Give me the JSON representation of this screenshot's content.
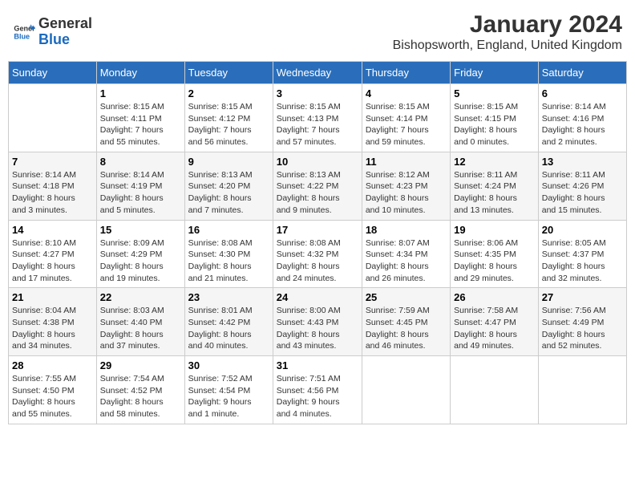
{
  "header": {
    "logo_general": "General",
    "logo_blue": "Blue",
    "main_title": "January 2024",
    "sub_title": "Bishopsworth, England, United Kingdom"
  },
  "days_of_week": [
    "Sunday",
    "Monday",
    "Tuesday",
    "Wednesday",
    "Thursday",
    "Friday",
    "Saturday"
  ],
  "weeks": [
    [
      {
        "day": "",
        "info": ""
      },
      {
        "day": "1",
        "info": "Sunrise: 8:15 AM\nSunset: 4:11 PM\nDaylight: 7 hours\nand 55 minutes."
      },
      {
        "day": "2",
        "info": "Sunrise: 8:15 AM\nSunset: 4:12 PM\nDaylight: 7 hours\nand 56 minutes."
      },
      {
        "day": "3",
        "info": "Sunrise: 8:15 AM\nSunset: 4:13 PM\nDaylight: 7 hours\nand 57 minutes."
      },
      {
        "day": "4",
        "info": "Sunrise: 8:15 AM\nSunset: 4:14 PM\nDaylight: 7 hours\nand 59 minutes."
      },
      {
        "day": "5",
        "info": "Sunrise: 8:15 AM\nSunset: 4:15 PM\nDaylight: 8 hours\nand 0 minutes."
      },
      {
        "day": "6",
        "info": "Sunrise: 8:14 AM\nSunset: 4:16 PM\nDaylight: 8 hours\nand 2 minutes."
      }
    ],
    [
      {
        "day": "7",
        "info": "Sunrise: 8:14 AM\nSunset: 4:18 PM\nDaylight: 8 hours\nand 3 minutes."
      },
      {
        "day": "8",
        "info": "Sunrise: 8:14 AM\nSunset: 4:19 PM\nDaylight: 8 hours\nand 5 minutes."
      },
      {
        "day": "9",
        "info": "Sunrise: 8:13 AM\nSunset: 4:20 PM\nDaylight: 8 hours\nand 7 minutes."
      },
      {
        "day": "10",
        "info": "Sunrise: 8:13 AM\nSunset: 4:22 PM\nDaylight: 8 hours\nand 9 minutes."
      },
      {
        "day": "11",
        "info": "Sunrise: 8:12 AM\nSunset: 4:23 PM\nDaylight: 8 hours\nand 10 minutes."
      },
      {
        "day": "12",
        "info": "Sunrise: 8:11 AM\nSunset: 4:24 PM\nDaylight: 8 hours\nand 13 minutes."
      },
      {
        "day": "13",
        "info": "Sunrise: 8:11 AM\nSunset: 4:26 PM\nDaylight: 8 hours\nand 15 minutes."
      }
    ],
    [
      {
        "day": "14",
        "info": "Sunrise: 8:10 AM\nSunset: 4:27 PM\nDaylight: 8 hours\nand 17 minutes."
      },
      {
        "day": "15",
        "info": "Sunrise: 8:09 AM\nSunset: 4:29 PM\nDaylight: 8 hours\nand 19 minutes."
      },
      {
        "day": "16",
        "info": "Sunrise: 8:08 AM\nSunset: 4:30 PM\nDaylight: 8 hours\nand 21 minutes."
      },
      {
        "day": "17",
        "info": "Sunrise: 8:08 AM\nSunset: 4:32 PM\nDaylight: 8 hours\nand 24 minutes."
      },
      {
        "day": "18",
        "info": "Sunrise: 8:07 AM\nSunset: 4:34 PM\nDaylight: 8 hours\nand 26 minutes."
      },
      {
        "day": "19",
        "info": "Sunrise: 8:06 AM\nSunset: 4:35 PM\nDaylight: 8 hours\nand 29 minutes."
      },
      {
        "day": "20",
        "info": "Sunrise: 8:05 AM\nSunset: 4:37 PM\nDaylight: 8 hours\nand 32 minutes."
      }
    ],
    [
      {
        "day": "21",
        "info": "Sunrise: 8:04 AM\nSunset: 4:38 PM\nDaylight: 8 hours\nand 34 minutes."
      },
      {
        "day": "22",
        "info": "Sunrise: 8:03 AM\nSunset: 4:40 PM\nDaylight: 8 hours\nand 37 minutes."
      },
      {
        "day": "23",
        "info": "Sunrise: 8:01 AM\nSunset: 4:42 PM\nDaylight: 8 hours\nand 40 minutes."
      },
      {
        "day": "24",
        "info": "Sunrise: 8:00 AM\nSunset: 4:43 PM\nDaylight: 8 hours\nand 43 minutes."
      },
      {
        "day": "25",
        "info": "Sunrise: 7:59 AM\nSunset: 4:45 PM\nDaylight: 8 hours\nand 46 minutes."
      },
      {
        "day": "26",
        "info": "Sunrise: 7:58 AM\nSunset: 4:47 PM\nDaylight: 8 hours\nand 49 minutes."
      },
      {
        "day": "27",
        "info": "Sunrise: 7:56 AM\nSunset: 4:49 PM\nDaylight: 8 hours\nand 52 minutes."
      }
    ],
    [
      {
        "day": "28",
        "info": "Sunrise: 7:55 AM\nSunset: 4:50 PM\nDaylight: 8 hours\nand 55 minutes."
      },
      {
        "day": "29",
        "info": "Sunrise: 7:54 AM\nSunset: 4:52 PM\nDaylight: 8 hours\nand 58 minutes."
      },
      {
        "day": "30",
        "info": "Sunrise: 7:52 AM\nSunset: 4:54 PM\nDaylight: 9 hours\nand 1 minute."
      },
      {
        "day": "31",
        "info": "Sunrise: 7:51 AM\nSunset: 4:56 PM\nDaylight: 9 hours\nand 4 minutes."
      },
      {
        "day": "",
        "info": ""
      },
      {
        "day": "",
        "info": ""
      },
      {
        "day": "",
        "info": ""
      }
    ]
  ]
}
